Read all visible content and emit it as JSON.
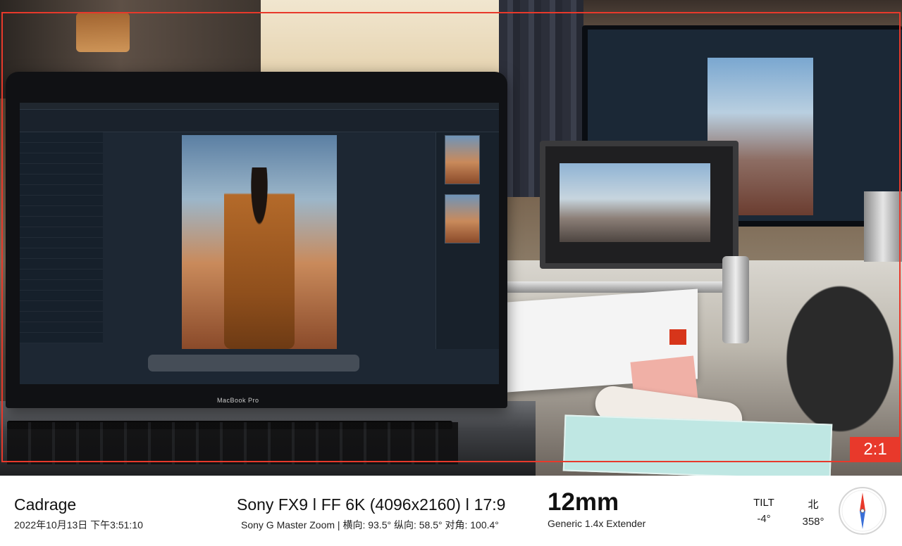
{
  "frame": {
    "aspect_ratio_badge": "2:1",
    "guide_color": "#e8392b"
  },
  "scene": {
    "laptop_brand": "MacBook Pro"
  },
  "info": {
    "app_name": "Cadrage",
    "capture_time": "2022年10月13日 下午3:51:10",
    "camera_line": "Sony FX9 ǀ FF 6K (4096x2160) ǀ 17:9",
    "lens_line": "Sony G Master Zoom  |  横向: 93.5°  纵向: 58.5°  对角: 100.4°",
    "focal_length": "12mm",
    "extender": "Generic 1.4x Extender",
    "tilt_label": "TILT",
    "tilt_value": "-4°",
    "heading_label": "北",
    "heading_value": "358°",
    "compass_icon": "compass-icon",
    "needle_north_color": "#e8392b",
    "needle_south_color": "#3a6fd8"
  }
}
